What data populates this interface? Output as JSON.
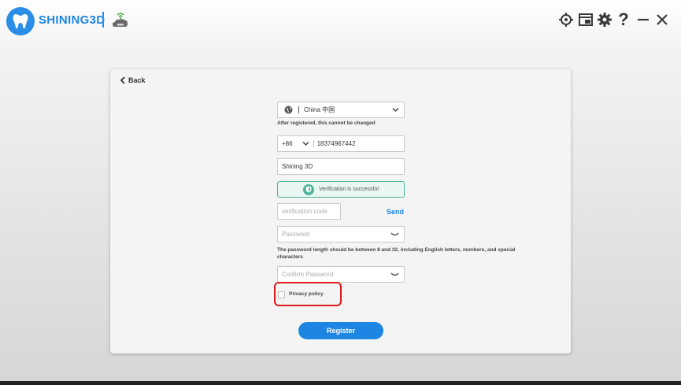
{
  "app": {
    "brand": "SHINING3D"
  },
  "titlebar": {
    "icons": [
      "tooth-logo-icon",
      "cloud-wifi-icon",
      "target-icon",
      "screenshot-icon",
      "gear-icon",
      "help-icon",
      "minimize-icon",
      "close-icon"
    ],
    "help_label": "?"
  },
  "form": {
    "back_label": "Back",
    "country": {
      "value": "China 中国",
      "icon": "globe-icon"
    },
    "country_hint": "After registered, this cannot be changed",
    "phone": {
      "code": "+86",
      "number": "18374967442"
    },
    "name_value": "Shining 3D",
    "verification_status": "Verification is successful",
    "code_placeholder": "verification code",
    "send_label": "Send",
    "password_placeholder": "Password",
    "password_hint": "The password length should be between 8 and 32, including English letters, numbers, and special characters",
    "confirm_placeholder": "Confirm Password",
    "privacy_label": "Privacy policy",
    "register_label": "Register"
  },
  "colors": {
    "accent": "#1d86e3",
    "success": "#4ab59a",
    "highlight": "#e11a1a"
  }
}
